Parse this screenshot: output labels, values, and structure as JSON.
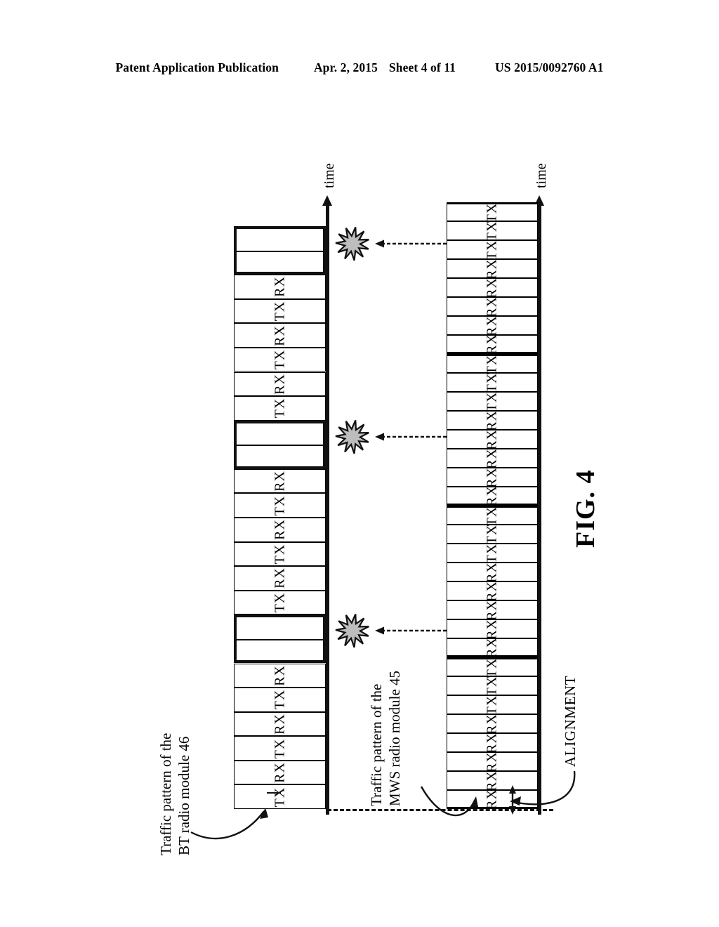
{
  "header": {
    "publication": "Patent Application Publication",
    "date": "Apr. 2, 2015",
    "sheet": "Sheet 4 of 11",
    "number": "US 2015/0092760 A1"
  },
  "figure": {
    "label": "FIG. 4",
    "time_axis_label_bt": "time",
    "time_axis_label_mws": "time",
    "alignment_label": "ALIGNMENT",
    "caption_bt_line1": "Traffic pattern of the",
    "caption_bt_line2": "BT radio module 46",
    "caption_mws_line1": "Traffic pattern of the",
    "caption_mws_line2": "MWS radio module 45",
    "collision_marker_name": "starburst-collision-icon",
    "collision_count": 3
  },
  "colors": {
    "ink": "#111111",
    "paper": "#ffffff"
  },
  "chart_data": {
    "type": "table",
    "title": "FIG. 4 — BT / MWS traffic pattern timing diagram",
    "xlabel": "time",
    "ylabel": "",
    "grid": false,
    "legend": "none",
    "series": [
      {
        "name": "Traffic pattern of the BT radio module 46",
        "slot_type_legend": [
          "TX",
          "RX",
          "blank"
        ],
        "values": [
          "TX",
          "RX",
          "TX",
          "RX",
          "TX",
          "RX",
          "blank",
          "blank",
          "TX",
          "RX",
          "TX",
          "RX",
          "TX",
          "RX",
          "blank",
          "blank",
          "TX",
          "RX",
          "TX",
          "RX",
          "TX",
          "RX",
          "blank",
          "blank"
        ]
      },
      {
        "name": "Traffic pattern of the MWS radio module 45",
        "slot_type_legend": [
          "TX",
          "RX"
        ],
        "frame_size": 8,
        "values": [
          "RX",
          "RX",
          "RX",
          "RX",
          "RX",
          "TX",
          "TX",
          "TX",
          "RX",
          "RX",
          "RX",
          "RX",
          "RX",
          "TX",
          "TX",
          "TX",
          "RX",
          "RX",
          "RX",
          "RX",
          "RX",
          "TX",
          "TX",
          "TX",
          "RX",
          "RX",
          "RX",
          "RX",
          "RX",
          "TX",
          "TX",
          "TX"
        ]
      }
    ],
    "annotations": [
      "starburst collision marker between MWS TX burst and BT blank block (x3)",
      "ALIGNMENT double-headed arrow at frame start",
      "dashed horizontal alignment reference line"
    ]
  }
}
